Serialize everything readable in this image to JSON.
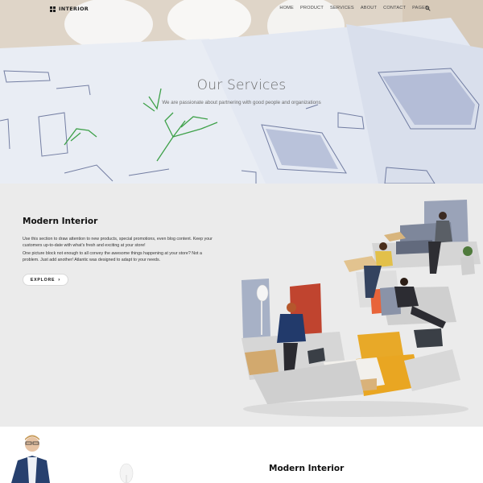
{
  "brand": {
    "name": "INTERIOR"
  },
  "nav": {
    "items": [
      "HOME",
      "PRODUCT",
      "SERVICES",
      "ABOUT",
      "CONTACT",
      "PAGES"
    ],
    "search_icon": "search-icon"
  },
  "hero": {
    "title": "Our Services",
    "subtitle": "We are passionate about partnering with good people and organizations"
  },
  "feature": {
    "title": "Modern Interior",
    "paragraph1": "Use this section to draw attention to new products, special promotions, even blog content. Keep your customers up-to-date with what's fresh and exciting at your store!",
    "paragraph2": "One picture block not enough to all convey the awesome things happening at your store? Not a problem. Just add another! Atlantic was designed to adapt to your needs.",
    "button_label": "EXPLORE",
    "button_icon": "chevron-right-icon"
  },
  "next_section": {
    "title": "Modern Interior"
  },
  "colors": {
    "section_bg": "#ebebeb",
    "accent_yellow": "#e8a928",
    "text_dark": "#111111"
  }
}
